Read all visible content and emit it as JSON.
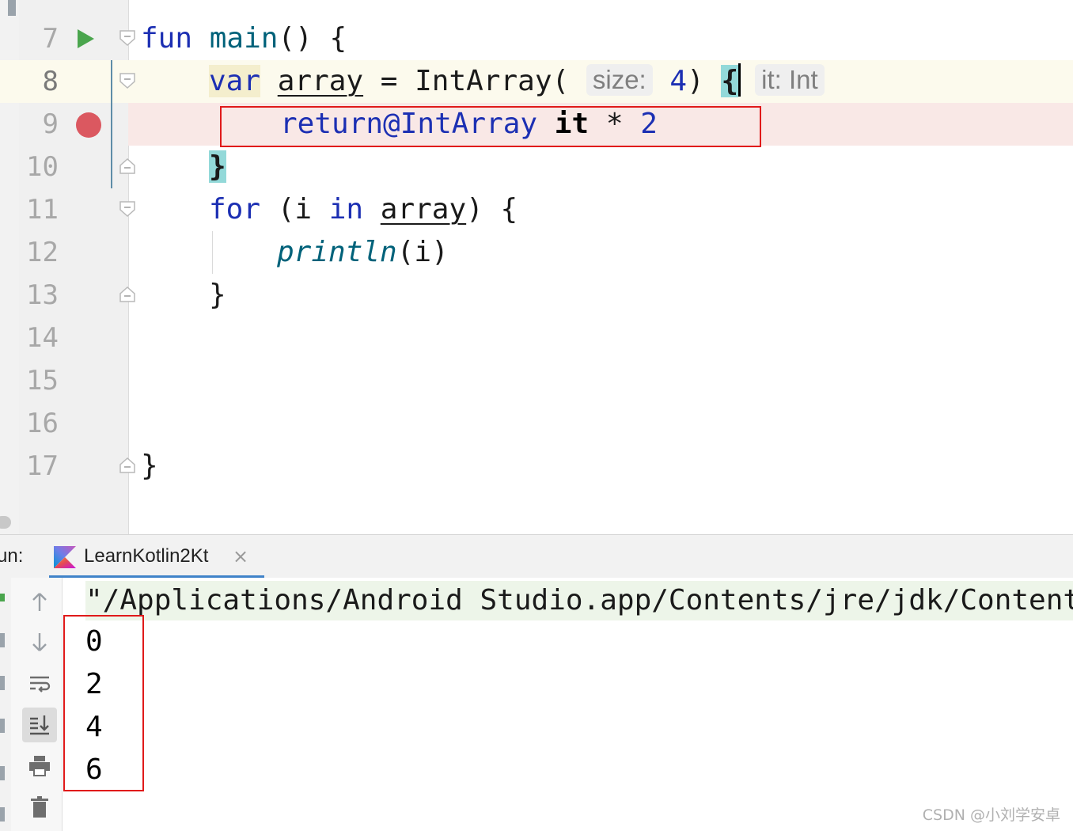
{
  "editor": {
    "lines": [
      {
        "number": "7"
      },
      {
        "number": "8"
      },
      {
        "number": "9"
      },
      {
        "number": "10"
      },
      {
        "number": "11"
      },
      {
        "number": "12"
      },
      {
        "number": "13"
      },
      {
        "number": "14"
      },
      {
        "number": "15"
      },
      {
        "number": "16"
      },
      {
        "number": "17"
      }
    ],
    "code": {
      "l7_kw": "fun",
      "l7_name": "main",
      "l7_rest": "() {",
      "l8_kw": "var",
      "l8_var": "array",
      "l8_eq": " = IntArray(",
      "l8_hint": "size:",
      "l8_num": "4",
      "l8_close": ")",
      "l8_brace": "{",
      "l8_it_hint": "it: Int",
      "l9_return": "return@IntArray",
      "l9_it": "it",
      "l9_op": " * ",
      "l9_num": "2",
      "l10_brace": "}",
      "l11_kw_for": "for",
      "l11_paren": " (i ",
      "l11_kw_in": "in",
      "l11_var": "array",
      "l11_rest": ") {",
      "l12_fn": "println",
      "l12_rest": "(i)",
      "l13_brace": "}",
      "l17_brace": "}"
    }
  },
  "run_panel": {
    "label": "un:",
    "tab_label": "LearnKotlin2Kt",
    "tab_close": "×",
    "command": "\"/Applications/Android Studio.app/Contents/jre/jdk/Contents/Home/bin/java\"",
    "output": [
      "0",
      "2",
      "4",
      "6"
    ],
    "tools": [
      "up-arrow-icon",
      "down-arrow-icon",
      "soft-wrap-icon",
      "scroll-to-end-icon",
      "print-icon",
      "trash-icon"
    ]
  },
  "colors": {
    "keyword": "#1c2fb3",
    "function": "#00627a",
    "breakpoint": "#db5860",
    "run": "#4aa54d",
    "annotation_box": "#e01a1a"
  },
  "watermark": "CSDN @小刘学安卓"
}
